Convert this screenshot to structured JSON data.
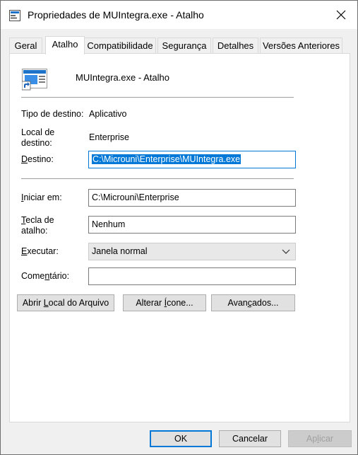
{
  "window": {
    "title": "Propriedades de MUIntegra.exe - Atalho"
  },
  "tabs": [
    {
      "label": "Geral"
    },
    {
      "label": "Atalho"
    },
    {
      "label": "Compatibilidade"
    },
    {
      "label": "Segurança"
    },
    {
      "label": "Detalhes"
    },
    {
      "label": "Versões Anteriores"
    }
  ],
  "header": {
    "app_name": "MUIntegra.exe - Atalho"
  },
  "fields": {
    "tipo_destino_label": "Tipo de destino:",
    "tipo_destino_value": "Aplicativo",
    "local_destino_label_1": "Local de",
    "local_destino_label_2": "destino:",
    "local_destino_value": "Enterprise",
    "destino_label_pre": "D",
    "destino_label_post": "estino:",
    "destino_value": "C:\\Microuni\\Enterprise\\MUIntegra.exe",
    "iniciar_label_pre": "I",
    "iniciar_label_post": "niciar em:",
    "iniciar_value": "C:\\Microuni\\Enterprise",
    "tecla_label_pre": "T",
    "tecla_label_post": "ecla de",
    "tecla_label_2": "atalho:",
    "tecla_value": "Nenhum",
    "executar_label_pre": "E",
    "executar_label_post": "xecutar:",
    "executar_value": "Janela normal",
    "comentario_label_pre": "Come",
    "comentario_label_u": "n",
    "comentario_label_post": "tário:",
    "comentario_value": ""
  },
  "buttons": {
    "abrir_pre": "Abrir ",
    "abrir_u": "L",
    "abrir_post": "ocal do Arquivo",
    "alterar_pre": "Alterar ",
    "alterar_u": "Í",
    "alterar_post": "cone...",
    "avancados_pre": "Avan",
    "avancados_u": "ç",
    "avancados_post": "ados...",
    "ok": "OK",
    "cancelar": "Cancelar",
    "aplicar_pre": "Ap",
    "aplicar_u": "l",
    "aplicar_post": "icar"
  }
}
